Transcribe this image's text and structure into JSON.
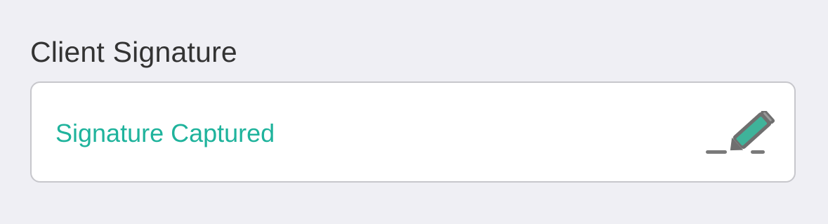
{
  "signature": {
    "label": "Client Signature",
    "status_text": "Signature Captured",
    "icon": "pen-sign-icon",
    "status_color": "#1fb39c",
    "icon_accent": "#3fb39a",
    "icon_gray": "#7a7a7a"
  }
}
